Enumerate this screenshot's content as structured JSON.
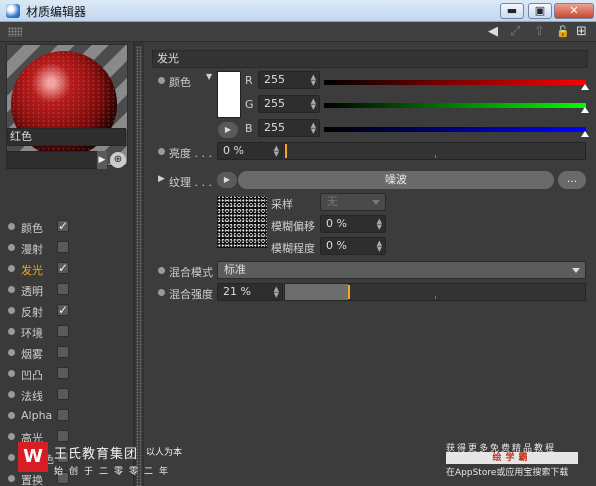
{
  "window": {
    "title": "材质编辑器",
    "buttons": {
      "minimize": "▬",
      "maximize": "▣",
      "close": "✕"
    }
  },
  "toolbar": {
    "icons": [
      "back-arrow-icon",
      "forward-arrow-icon",
      "lock-icon",
      "add-window-icon"
    ],
    "glyphs": {
      "back": "◀",
      "forward": "⤢",
      "lock": "🔓",
      "plus": "⊞"
    }
  },
  "left": {
    "material_name": "红色",
    "picker_glyph": "⊕",
    "channels": [
      {
        "label": "颜色",
        "checked": true,
        "mark": "✓"
      },
      {
        "label": "漫射",
        "checked": false,
        "mark": ""
      },
      {
        "label": "发光",
        "checked": true,
        "mark": "✓",
        "active": true
      },
      {
        "label": "透明",
        "checked": false,
        "mark": ""
      },
      {
        "label": "反射",
        "checked": true,
        "mark": "✓"
      },
      {
        "label": "环境",
        "checked": false,
        "mark": ""
      },
      {
        "label": "烟雾",
        "checked": false,
        "mark": ""
      },
      {
        "label": "凹凸",
        "checked": false,
        "mark": ""
      },
      {
        "label": "法线",
        "checked": false,
        "mark": ""
      },
      {
        "label": "Alpha",
        "checked": false,
        "mark": ""
      },
      {
        "label": "高光",
        "checked": false,
        "mark": ""
      },
      {
        "label": "高光色",
        "checked": false,
        "mark": ""
      },
      {
        "label": "置换",
        "checked": false,
        "mark": ""
      }
    ]
  },
  "panel": {
    "section_title": "发光",
    "color": {
      "label": "颜色",
      "swatch": "#ffffff",
      "r_label": "R",
      "r": "255",
      "g_label": "G",
      "g": "255",
      "b_label": "B",
      "b": "255"
    },
    "brightness": {
      "label": "亮度 . . .",
      "value": "0 %",
      "level": 0.0
    },
    "texture": {
      "label": "纹理 . . .",
      "shader": "噪波",
      "more": "...",
      "sampling_label": "采样",
      "sampling_value": "无",
      "blur_offset_label": "模糊偏移",
      "blur_offset_value": "0 %",
      "blur_scale_label": "模糊程度",
      "blur_scale_value": "0 %"
    },
    "mix_mode": {
      "label": "混合模式",
      "value": "标准"
    },
    "mix_strength": {
      "label": "混合强度",
      "value": "21 %",
      "level": 0.21
    }
  },
  "watermark": {
    "logo": "W",
    "company": "王氏教育集团",
    "tagline": "以人为本",
    "line": "始创于二零零二年",
    "right_line1": "获得更多免费精品教程",
    "right_line2": "绘学霸",
    "right_line3": "在AppStore或应用宝搜索下载"
  },
  "colors": {
    "accent": "#f5a623",
    "background": "#3c3c3c",
    "field": "#2e2e2e",
    "logo_red": "#d81d24"
  }
}
